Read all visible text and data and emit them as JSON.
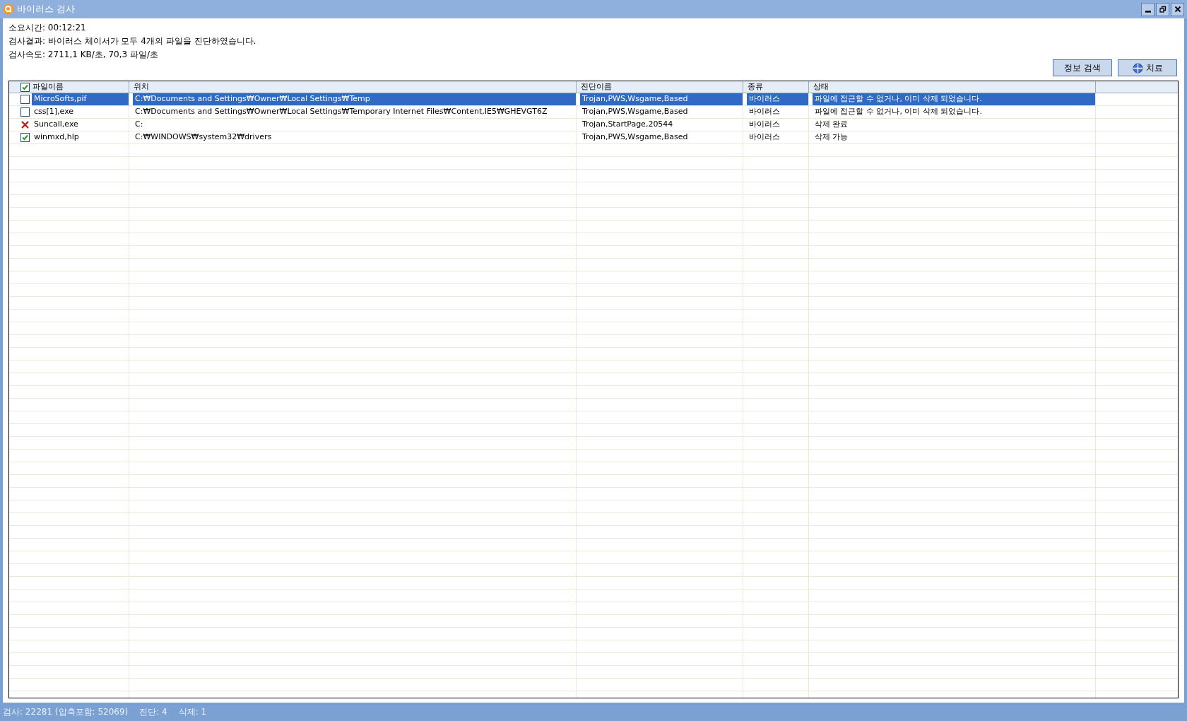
{
  "window": {
    "title": "바이러스 검사"
  },
  "summary": [
    "소요시간: 00:12:21",
    "검사결과: 바이러스 체이서가 모두 4개의 파일을 진단하였습니다.",
    "검사속도: 2711,1 KB/초, 70,3 파일/초"
  ],
  "buttons": [
    {
      "label": "정보 검색",
      "icon": false
    },
    {
      "label": "치료",
      "icon": true
    }
  ],
  "table": {
    "header_checked": true,
    "columns": [
      "파일이름",
      "위치",
      "진단이름",
      "종류",
      "상태"
    ],
    "rows": [
      {
        "kind": "checkbox",
        "checked": false,
        "selected": true,
        "cells": [
          "MicroSofts,pif",
          "C:₩Documents and Settings₩Owner₩Local Settings₩Temp",
          "Trojan,PWS,Wsgame,Based",
          "바이러스",
          "파일에 접근할 수 없거나, 이미 삭제 되었습니다."
        ]
      },
      {
        "kind": "checkbox",
        "checked": false,
        "selected": false,
        "cells": [
          "css[1],exe",
          "C:₩Documents and Settings₩Owner₩Local Settings₩Temporary Internet Files₩Content,IE5₩GHEVGT6Z",
          "Trojan,PWS,Wsgame,Based",
          "바이러스",
          "파일에 접근할 수 없거나, 이미 삭제 되었습니다."
        ]
      },
      {
        "kind": "removed",
        "selected": false,
        "cells": [
          "Suncall,exe",
          "C:",
          "Trojan,StartPage,20544",
          "바이러스",
          "삭제 완료"
        ]
      },
      {
        "kind": "checkbox",
        "checked": true,
        "selected": false,
        "cells": [
          "winmxd,hlp",
          "C:₩WINDOWS₩system32₩drivers",
          "Trojan,PWS,Wsgame,Based",
          "바이러스",
          "삭제 가능"
        ]
      }
    ]
  },
  "status_bar": [
    "검사: 22281 (압축포함: 52069)",
    "진단: 4",
    "삭제: 1"
  ]
}
